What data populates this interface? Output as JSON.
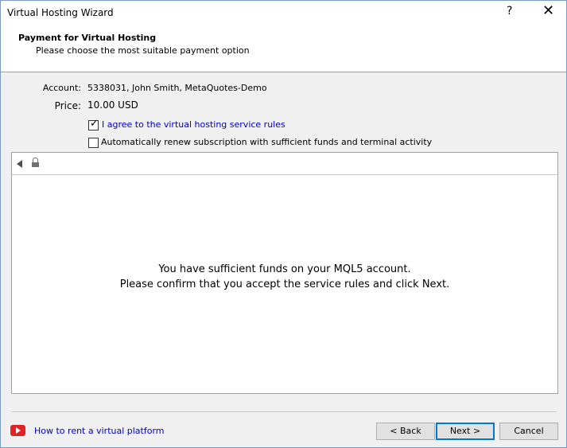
{
  "window": {
    "title": "Virtual Hosting Wizard",
    "help_label": "?",
    "close_label": "✕"
  },
  "header": {
    "title": "Payment for Virtual Hosting",
    "subtitle": "Please choose the most suitable payment option"
  },
  "details": {
    "account_label": "Account:",
    "account_value": "5338031, John Smith, MetaQuotes-Demo",
    "price_label": "Price:",
    "price_value": "10.00 USD"
  },
  "options": {
    "agree_label": "I agree to the virtual hosting service rules",
    "agree_checked": true,
    "renew_label": "Automatically renew subscription with sufficient funds and terminal activity",
    "renew_checked": false
  },
  "browser": {
    "message_line1": "You have sufficient funds on your MQL5 account.",
    "message_line2": "Please confirm that you accept the service rules and click Next."
  },
  "footer": {
    "help_link": "How to rent a virtual platform",
    "back_label": "< Back",
    "next_label": "Next >",
    "cancel_label": "Cancel"
  },
  "colors": {
    "link": "#0000cc",
    "accent": "#0078d7",
    "youtube": "#e02424"
  }
}
